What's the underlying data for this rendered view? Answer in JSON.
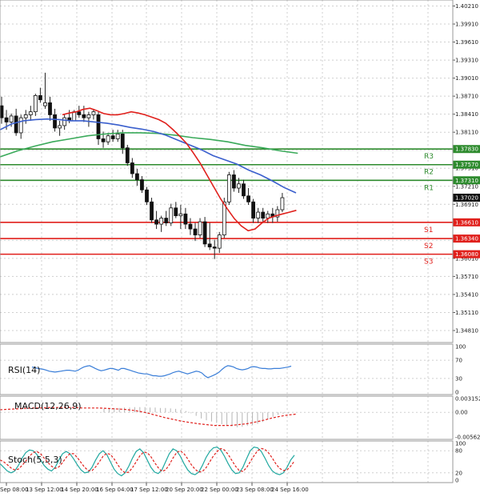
{
  "chart_data": {
    "type": "line",
    "main": {
      "ylim": [
        1.3461,
        1.4031
      ],
      "y_ticks": [
        "1.40210",
        "1.39910",
        "1.39610",
        "1.39310",
        "1.39010",
        "1.38710",
        "1.38410",
        "1.38110",
        "1.37810",
        "1.37510",
        "1.37210",
        "1.36910",
        "1.36610",
        "1.36310",
        "1.36010",
        "1.35710",
        "1.35410",
        "1.35110",
        "1.34810"
      ],
      "x_ticks": [
        "Sep 08:00",
        "13 Sep 12:00",
        "14 Sep 20:00",
        "16 Sep 04:00",
        "17 Sep 12:00",
        "20 Sep 20:00",
        "22 Sep 00:00",
        "23 Sep 08:00",
        "24 Sep 16:00"
      ],
      "candles": [
        [
          1.3855,
          1.387,
          1.3825,
          1.3835
        ],
        [
          1.3835,
          1.3848,
          1.3815,
          1.3828
        ],
        [
          1.3828,
          1.3842,
          1.382,
          1.3838
        ],
        [
          1.3838,
          1.385,
          1.3805,
          1.381
        ],
        [
          1.381,
          1.384,
          1.38,
          1.3835
        ],
        [
          1.3835,
          1.3848,
          1.3825,
          1.384
        ],
        [
          1.384,
          1.3855,
          1.383,
          1.3845
        ],
        [
          1.3845,
          1.3875,
          1.3838,
          1.3872
        ],
        [
          1.3872,
          1.3885,
          1.386,
          1.3865
        ],
        [
          1.3855,
          1.391,
          1.385,
          1.386
        ],
        [
          1.386,
          1.387,
          1.383,
          1.384
        ],
        [
          1.384,
          1.385,
          1.3812,
          1.3818
        ],
        [
          1.3818,
          1.383,
          1.3805,
          1.3822
        ],
        [
          1.3822,
          1.384,
          1.3815,
          1.3835
        ],
        [
          1.3835,
          1.3848,
          1.3826,
          1.383
        ],
        [
          1.383,
          1.3848,
          1.383,
          1.3845
        ],
        [
          1.3845,
          1.3855,
          1.3835,
          1.384
        ],
        [
          1.384,
          1.3855,
          1.3828,
          1.3835
        ],
        [
          1.3835,
          1.3845,
          1.382,
          1.384
        ],
        [
          1.384,
          1.385,
          1.3832,
          1.3845
        ],
        [
          1.384,
          1.3845,
          1.379,
          1.38
        ],
        [
          1.38,
          1.3812,
          1.3785,
          1.3795
        ],
        [
          1.3795,
          1.381,
          1.379,
          1.3805
        ],
        [
          1.3805,
          1.3815,
          1.3795,
          1.38
        ],
        [
          1.38,
          1.3815,
          1.3795,
          1.3808
        ],
        [
          1.3808,
          1.3815,
          1.3775,
          1.3785
        ],
        [
          1.3785,
          1.379,
          1.3755,
          1.376
        ],
        [
          1.376,
          1.3768,
          1.3735,
          1.3742
        ],
        [
          1.3742,
          1.375,
          1.3722,
          1.3732
        ],
        [
          1.3732,
          1.3738,
          1.371,
          1.3715
        ],
        [
          1.3715,
          1.372,
          1.369,
          1.3695
        ],
        [
          1.3695,
          1.3702,
          1.366,
          1.3665
        ],
        [
          1.3665,
          1.368,
          1.365,
          1.3658
        ],
        [
          1.3658,
          1.3672,
          1.3645,
          1.3668
        ],
        [
          1.3668,
          1.368,
          1.3655,
          1.366
        ],
        [
          1.366,
          1.3692,
          1.3655,
          1.3685
        ],
        [
          1.3685,
          1.3695,
          1.3668,
          1.3672
        ],
        [
          1.3672,
          1.369,
          1.365,
          1.3675
        ],
        [
          1.3675,
          1.3685,
          1.365,
          1.3658
        ],
        [
          1.3658,
          1.3668,
          1.364,
          1.365
        ],
        [
          1.365,
          1.366,
          1.363,
          1.364
        ],
        [
          1.364,
          1.3668,
          1.3635,
          1.3662
        ],
        [
          1.3662,
          1.367,
          1.362,
          1.3625
        ],
        [
          1.3625,
          1.366,
          1.3615,
          1.362
        ],
        [
          1.362,
          1.3632,
          1.36,
          1.3618
        ],
        [
          1.3618,
          1.3645,
          1.361,
          1.364
        ],
        [
          1.364,
          1.3702,
          1.3635,
          1.3695
        ],
        [
          1.3695,
          1.3745,
          1.369,
          1.374
        ],
        [
          1.374,
          1.3748,
          1.3712,
          1.3718
        ],
        [
          1.3718,
          1.3735,
          1.371,
          1.3725
        ],
        [
          1.3725,
          1.3732,
          1.37,
          1.3705
        ],
        [
          1.3705,
          1.3718,
          1.369,
          1.3695
        ],
        [
          1.3695,
          1.37,
          1.366,
          1.3668
        ],
        [
          1.3668,
          1.3685,
          1.366,
          1.3678
        ],
        [
          1.3678,
          1.3685,
          1.366,
          1.3668
        ],
        [
          1.3668,
          1.368,
          1.366,
          1.3675
        ],
        [
          1.3675,
          1.3685,
          1.366,
          1.367
        ],
        [
          1.367,
          1.3688,
          1.3662,
          1.3682
        ],
        [
          1.3682,
          1.371,
          1.3678,
          1.3702
        ]
      ],
      "ema_red": [
        1.384,
        1.3843,
        1.3845,
        1.3849,
        1.3851,
        1.3847,
        1.3842,
        1.384,
        1.384,
        1.3842,
        1.3845,
        1.3843,
        1.384,
        1.3836,
        1.3832,
        1.3826,
        1.3816,
        1.3805,
        1.3793,
        1.3777,
        1.376,
        1.374,
        1.372,
        1.37,
        1.3683,
        1.3667,
        1.3655,
        1.3647,
        1.365,
        1.366,
        1.3668,
        1.3672,
        1.3675,
        1.3678,
        1.3681
      ],
      "ema_blue": [
        1.3815,
        1.3825,
        1.383,
        1.3832,
        1.3833,
        1.3832,
        1.383,
        1.383,
        1.3828,
        1.3826,
        1.3823,
        1.3819,
        1.3816,
        1.3812,
        1.3806,
        1.3798,
        1.379,
        1.3782,
        1.3772,
        1.3765,
        1.3758,
        1.3748,
        1.374,
        1.373,
        1.3719,
        1.371
      ],
      "ema_green": [
        1.377,
        1.378,
        1.3788,
        1.3795,
        1.38,
        1.3805,
        1.3808,
        1.381,
        1.381,
        1.3809,
        1.3806,
        1.3802,
        1.3799,
        1.3795,
        1.3789,
        1.3785,
        1.378,
        1.3776
      ],
      "levels": [
        {
          "name": "R3",
          "value": 1.3783,
          "label": "1.37830",
          "color": "#2e8b2e"
        },
        {
          "name": "R2",
          "value": 1.3757,
          "label": "1.37570",
          "color": "#2e8b2e"
        },
        {
          "name": "R1",
          "value": 1.3731,
          "label": "1.37310",
          "color": "#2e8b2e"
        },
        {
          "name": "S1",
          "value": 1.3661,
          "label": "1.36610",
          "color": "#e0201c"
        },
        {
          "name": "S2",
          "value": 1.3634,
          "label": "1.36340",
          "color": "#e0201c"
        },
        {
          "name": "S3",
          "value": 1.3608,
          "label": "1.36080",
          "color": "#e0201c"
        }
      ],
      "current": {
        "label": "1.37020",
        "value": 1.3702
      }
    },
    "rsi": {
      "label": "RSI(14)",
      "ylim": [
        0,
        100
      ],
      "ticks": [
        "100",
        "70",
        "30",
        "0"
      ],
      "values": [
        55,
        54,
        52,
        51,
        50,
        48,
        46,
        45,
        44,
        45,
        46,
        47,
        48,
        48,
        47,
        46,
        48,
        52,
        55,
        57,
        58,
        55,
        52,
        49,
        47,
        48,
        50,
        52,
        52,
        50,
        48,
        52,
        52,
        50,
        48,
        46,
        44,
        42,
        41,
        40,
        40,
        38,
        36,
        36,
        35,
        35,
        36,
        38,
        40,
        43,
        45,
        46,
        44,
        42,
        40,
        42,
        44,
        46,
        45,
        42,
        36,
        32,
        34,
        37,
        40,
        44,
        50,
        55,
        58,
        57,
        55,
        52,
        50,
        49,
        50,
        52,
        55,
        56,
        55,
        53,
        52,
        52,
        51,
        51,
        52,
        52,
        52,
        53,
        54,
        55,
        57
      ]
    },
    "macd": {
      "label": "MACD(12,26,9)",
      "ylim": [
        -0.005628,
        0.003152
      ],
      "ticks": [
        "0.003152",
        "0.00",
        "-0.005628"
      ],
      "histogram": [
        0.0008,
        0.0009,
        0.001,
        0.001,
        0.0011,
        0.0011,
        0.0012,
        0.0012,
        0.0012,
        0.0011,
        0.0011,
        0.001,
        0.001,
        0.0009,
        0.0008,
        0.0006,
        0.0003,
        -0.0002,
        -0.0008,
        -0.0014,
        -0.0018,
        -0.0021,
        -0.0024,
        -0.0027,
        -0.003,
        -0.0032,
        -0.0034,
        -0.0033,
        -0.0031,
        -0.0029,
        -0.0026,
        -0.0022,
        -0.0016,
        -0.001,
        -0.0006,
        -0.0003,
        -0.0002
      ],
      "signal": [
        0.0006,
        0.0007,
        0.0008,
        0.0009,
        0.001,
        0.001,
        0.0011,
        0.0011,
        0.0011,
        0.0011,
        0.001,
        0.001,
        0.001,
        0.0009,
        0.0008,
        0.0007,
        0.0005,
        0.0002,
        -0.0002,
        -0.0007,
        -0.0012,
        -0.0016,
        -0.002,
        -0.0023,
        -0.0026,
        -0.0028,
        -0.003,
        -0.003,
        -0.003,
        -0.0028,
        -0.0026,
        -0.0022,
        -0.0018,
        -0.0013,
        -0.0009,
        -0.0006,
        -0.0004
      ]
    },
    "stoch": {
      "label": "Stoch(5,5,3)",
      "ylim": [
        0,
        100
      ],
      "ticks": [
        "100",
        "80",
        "20",
        "0"
      ],
      "k": [
        45,
        35,
        25,
        20,
        25,
        40,
        60,
        75,
        82,
        80,
        70,
        55,
        40,
        30,
        25,
        35,
        55,
        72,
        78,
        72,
        58,
        42,
        28,
        20,
        22,
        35,
        55,
        72,
        80,
        70,
        50,
        30,
        18,
        12,
        20,
        38,
        60,
        78,
        85,
        75,
        55,
        35,
        22,
        18,
        28,
        50,
        72,
        85,
        80,
        65,
        45,
        28,
        18,
        15,
        22,
        40,
        62,
        78,
        88,
        90,
        82,
        65,
        45,
        28,
        18,
        20,
        35,
        58,
        80,
        90,
        88,
        78,
        60,
        40,
        25,
        18,
        15,
        20,
        35,
        55,
        68
      ],
      "d": [
        55,
        50,
        42,
        33,
        28,
        30,
        40,
        52,
        65,
        75,
        78,
        72,
        60,
        48,
        38,
        32,
        36,
        48,
        62,
        72,
        72,
        62,
        48,
        35,
        26,
        26,
        36,
        50,
        65,
        73,
        70,
        58,
        42,
        28,
        20,
        22,
        34,
        50,
        66,
        76,
        75,
        64,
        48,
        34,
        24,
        28,
        42,
        60,
        75,
        80,
        72,
        58,
        42,
        30,
        22,
        24,
        34,
        50,
        66,
        78,
        86,
        82,
        70,
        54,
        38,
        26,
        24,
        34,
        50,
        66,
        80,
        86,
        84,
        74,
        60,
        44,
        32,
        26,
        28,
        38,
        52
      ]
    }
  }
}
